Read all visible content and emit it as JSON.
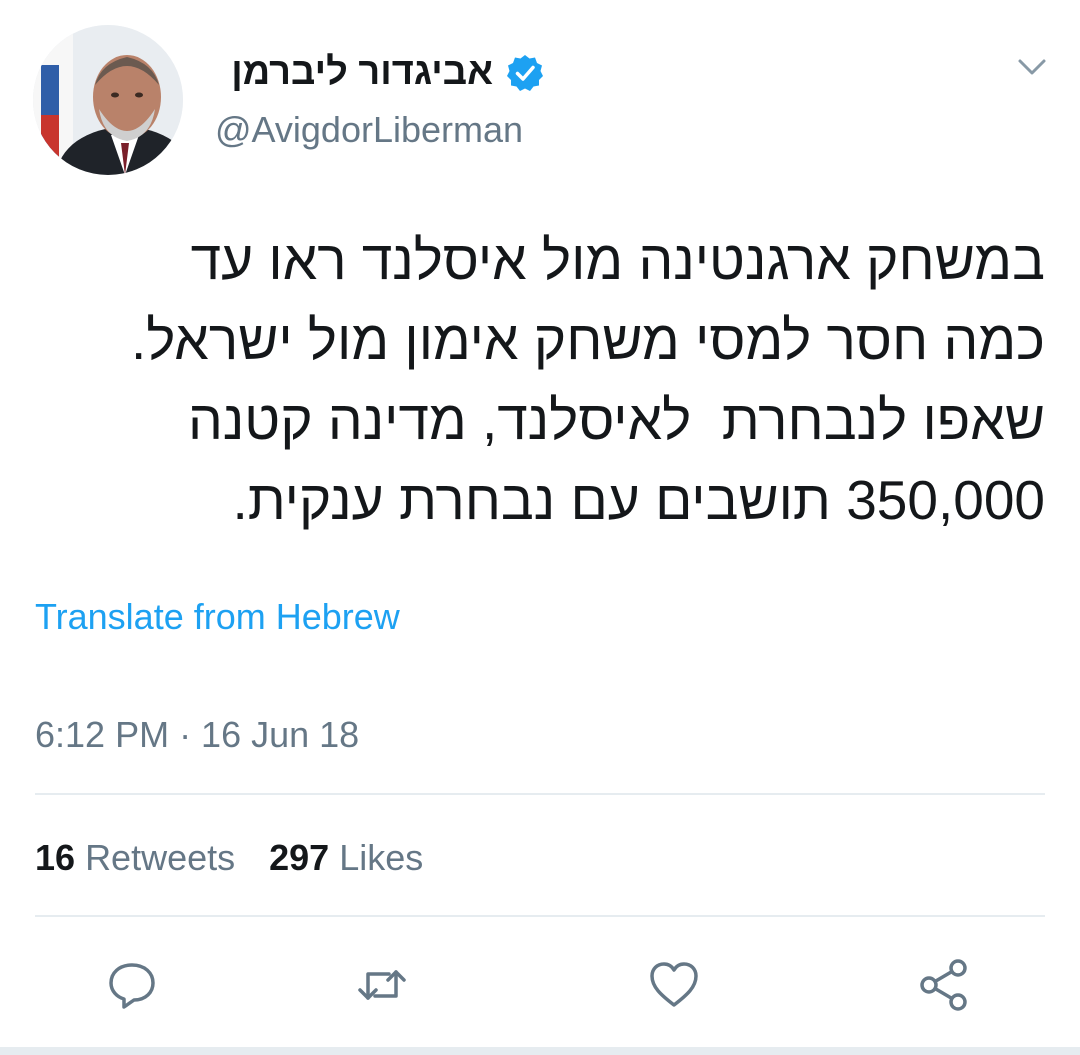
{
  "author": {
    "display_name": "אביגדור ליברמן",
    "handle": "@AvigdorLiberman",
    "verified_icon": "verified-badge-icon",
    "avatar": "profile-photo"
  },
  "tweet": {
    "text": "במשחק ארגנטינה מול איסלנד ראו עד\nכמה חסר למסי משחק אימון מול ישראל.\nשאפו לנבחרת  לאיסלנד, מדינה קטנה\n350,000 תושבים עם נבחרת ענקית.",
    "translate_label": "Translate from Hebrew",
    "timestamp": "6:12 PM · 16 Jun 18"
  },
  "stats": {
    "retweets_count": "16",
    "retweets_label": "Retweets",
    "likes_count": "297",
    "likes_label": "Likes"
  },
  "actions": [
    "reply-icon",
    "retweet-icon",
    "like-icon",
    "share-icon"
  ],
  "colors": {
    "accent": "#1da1f2",
    "text": "#14171a",
    "secondary": "#657786",
    "divider": "#e6ecf0"
  }
}
